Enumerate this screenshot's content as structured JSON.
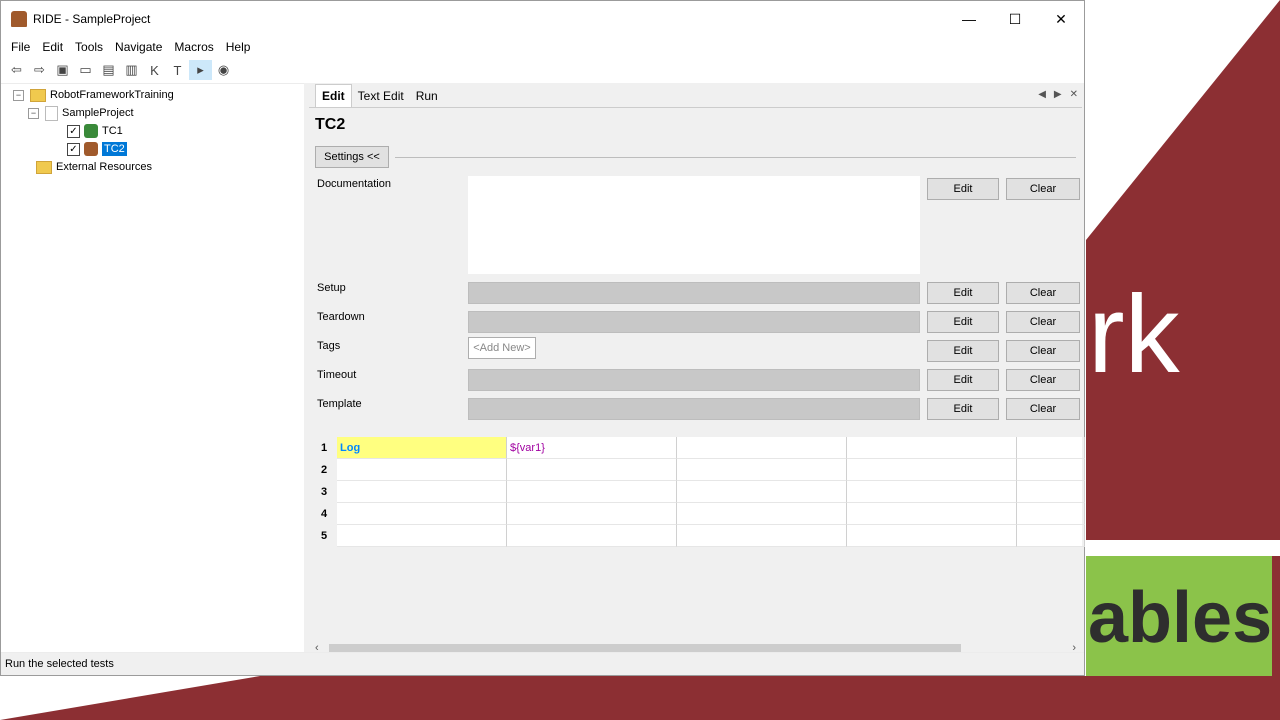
{
  "window": {
    "title": "RIDE - SampleProject",
    "minimize": "—",
    "maximize": "☐",
    "close": "✕"
  },
  "menu": [
    "File",
    "Edit",
    "Tools",
    "Navigate",
    "Macros",
    "Help"
  ],
  "toolbar": {
    "icons": [
      "back-icon",
      "forward-icon",
      "open-suite-icon",
      "open-directory-icon",
      "save-icon",
      "save-all-icon",
      "search-keywords-icon",
      "search-tests-icon",
      "run-icon",
      "stop-icon"
    ]
  },
  "tree": {
    "root": "RobotFrameworkTraining",
    "project": "SampleProject",
    "tests": [
      "TC1",
      "TC2"
    ],
    "external": "External Resources"
  },
  "tabs": [
    "Edit",
    "Text Edit",
    "Run"
  ],
  "editor": {
    "test_name": "TC2",
    "settings_label": "Settings <<",
    "fields": [
      "Documentation",
      "Setup",
      "Teardown",
      "Tags",
      "Timeout",
      "Template"
    ],
    "edit_label": "Edit",
    "clear_label": "Clear",
    "tags_placeholder": "<Add New>"
  },
  "grid": {
    "rows": [
      {
        "num": "1",
        "cells": [
          "Log",
          "${var1}",
          "",
          "",
          ""
        ]
      },
      {
        "num": "2",
        "cells": [
          "",
          "",
          "",
          "",
          ""
        ]
      },
      {
        "num": "3",
        "cells": [
          "",
          "",
          "",
          "",
          ""
        ]
      },
      {
        "num": "4",
        "cells": [
          "",
          "",
          "",
          "",
          ""
        ]
      },
      {
        "num": "5",
        "cells": [
          "",
          "",
          "",
          "",
          ""
        ]
      }
    ]
  },
  "status": "Run the selected tests",
  "background": {
    "text1": "rk",
    "text2": "ables"
  }
}
